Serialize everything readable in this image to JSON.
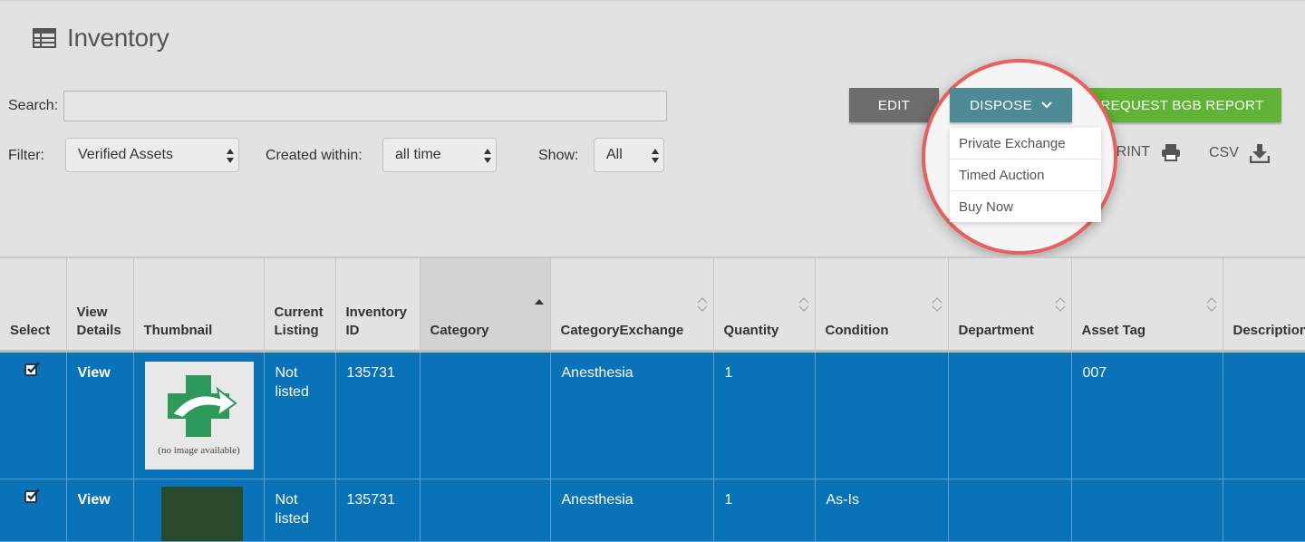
{
  "page": {
    "title": "Inventory",
    "icon": "table-icon"
  },
  "search": {
    "label": "Search:",
    "value": "",
    "placeholder": ""
  },
  "filters": {
    "filter_label": "Filter:",
    "filter_value": "Verified Assets",
    "created_label": "Created within:",
    "created_value": "all time",
    "show_label": "Show:",
    "show_value": "All"
  },
  "actions": {
    "edit": "EDIT",
    "dispose": "DISPOSE",
    "bgb": "REQUEST BGB REPORT",
    "print": "PRINT",
    "csv": "CSV"
  },
  "dispose_menu": [
    "Private Exchange",
    "Timed Auction",
    "Buy Now"
  ],
  "table": {
    "columns": [
      "Select",
      "View Details",
      "Thumbnail",
      "Current Listing",
      "Inventory ID",
      "Category",
      "CategoryExchange",
      "Quantity",
      "Condition",
      "Department",
      "Asset Tag",
      "Description"
    ],
    "rows": [
      {
        "view": "View",
        "thumbnail_caption": "(no image available)",
        "listing": "Not listed",
        "inventory_id": "135731",
        "category": "",
        "category_exchange": "Anesthesia",
        "quantity": "1",
        "condition": "",
        "department": "",
        "asset_tag": "007",
        "description": ""
      },
      {
        "view": "View",
        "thumbnail_caption": "",
        "listing": "Not listed",
        "inventory_id": "135731",
        "category": "",
        "category_exchange": "Anesthesia",
        "quantity": "1",
        "condition": "As-Is",
        "department": "",
        "asset_tag": "",
        "description": ""
      }
    ]
  },
  "colors": {
    "table_row": "#0a72b7",
    "dispose": "#4d8a96",
    "edit": "#6d6d6d",
    "bgb": "#5fb335",
    "highlight": "#e85f5b"
  }
}
